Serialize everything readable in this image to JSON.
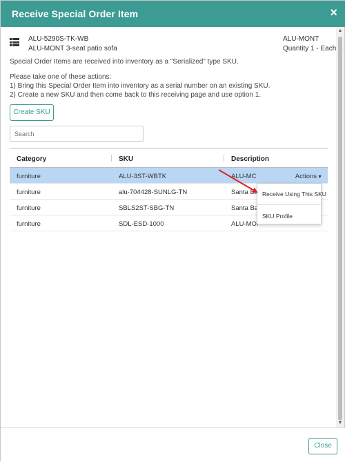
{
  "modal": {
    "title": "Receive Special Order Item",
    "close_glyph": "×"
  },
  "item": {
    "sku": "ALU-5290S-TK-WB",
    "description": "ALU-MONT 3-seat patio sofa",
    "vendor": "ALU-MONT",
    "quantity": "Quantity 1 - Each",
    "icon": "list-icon"
  },
  "notes": {
    "line1": "Special Order Items are received into inventory as a \"Serialized\" type SKU.",
    "line2": "Please take one of these actions:",
    "line3": "1) Bring this Special Order Item into inventory as a serial number on an existing SKU.",
    "line4": "2) Create a new SKU and then come back to this receiving page and use option 1."
  },
  "create_sku_label": "Create SKU",
  "search": {
    "placeholder": "Search"
  },
  "table": {
    "headers": {
      "category": "Category",
      "sku": "SKU",
      "description": "Description"
    },
    "rows": [
      {
        "category": "furniture",
        "sku": "ALU-3ST-WBTK",
        "description": "ALU-MC",
        "actions": "Actions",
        "selected": true
      },
      {
        "category": "furniture",
        "sku": "alu-704428-SUNLG-TN",
        "description": "Santa Ba"
      },
      {
        "category": "furniture",
        "sku": "SBLS2ST-SBG-TN",
        "description": "Santa Bar"
      },
      {
        "category": "furniture",
        "sku": "SDL-ESD-1000",
        "description": "ALU-MON"
      }
    ]
  },
  "dropdown": {
    "receive_label": "Receive Using This SKU",
    "profile_label": "SKU Profile"
  },
  "footer": {
    "close_label": "Close"
  },
  "colors": {
    "accent": "#3c9c94",
    "selected_row": "#b9d7f4",
    "arrow": "#e02020"
  }
}
